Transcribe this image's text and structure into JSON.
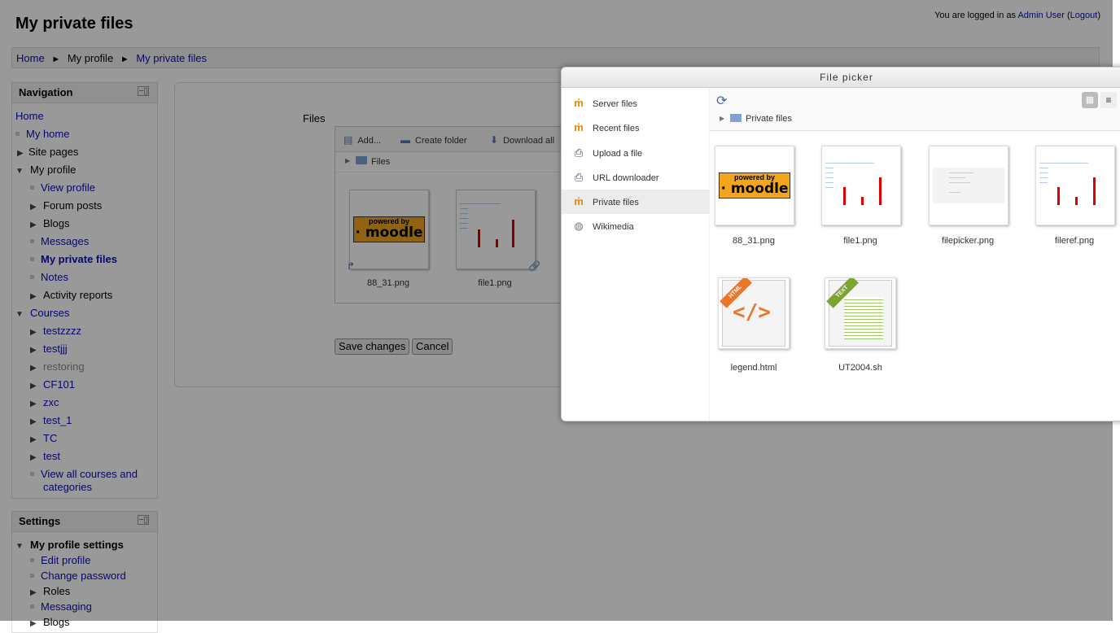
{
  "page": {
    "title": "My private files",
    "login": {
      "prefix": "You are logged in as ",
      "user": "Admin User",
      "logout": "Logout"
    }
  },
  "breadcrumb": {
    "home": "Home",
    "profile": "My profile",
    "current": "My private files",
    "sep": "►"
  },
  "navigation": {
    "title": "Navigation",
    "items": [
      {
        "label": "Home"
      },
      {
        "label": "My home"
      },
      {
        "label": "Site pages"
      },
      {
        "label": "My profile"
      },
      {
        "label": "View profile"
      },
      {
        "label": "Forum posts"
      },
      {
        "label": "Blogs"
      },
      {
        "label": "Messages"
      },
      {
        "label": "My private files"
      },
      {
        "label": "Notes"
      },
      {
        "label": "Activity reports"
      },
      {
        "label": "Courses"
      },
      {
        "label": "testzzzz"
      },
      {
        "label": "testjjj"
      },
      {
        "label": "restoring"
      },
      {
        "label": "CF101"
      },
      {
        "label": "zxc"
      },
      {
        "label": "test_1"
      },
      {
        "label": "TC"
      },
      {
        "label": "test"
      },
      {
        "label": "View all courses and"
      },
      {
        "label": "categories"
      }
    ]
  },
  "settings": {
    "title": "Settings",
    "items": [
      {
        "label": "My profile settings"
      },
      {
        "label": "Edit profile"
      },
      {
        "label": "Change password"
      },
      {
        "label": "Roles"
      },
      {
        "label": "Messaging"
      },
      {
        "label": "Blogs"
      }
    ]
  },
  "files_form": {
    "label": "Files",
    "toolbar": {
      "add": "Add...",
      "create_folder": "Create folder",
      "download_all": "Download all"
    },
    "path": "Files",
    "files": [
      {
        "name": "88_31.png"
      },
      {
        "name": "file1.png"
      }
    ],
    "save": "Save changes",
    "cancel": "Cancel"
  },
  "file_picker": {
    "title": "File picker",
    "repositories": [
      {
        "label": "Server files",
        "icon": "moodle-icon"
      },
      {
        "label": "Recent files",
        "icon": "moodle-icon"
      },
      {
        "label": "Upload a file",
        "icon": "upload-icon"
      },
      {
        "label": "URL downloader",
        "icon": "url-download-icon"
      },
      {
        "label": "Private files",
        "icon": "moodle-icon",
        "selected": true
      },
      {
        "label": "Wikimedia",
        "icon": "wikimedia-icon"
      }
    ],
    "path": "Private files",
    "files": [
      {
        "name": "88_31.png"
      },
      {
        "name": "file1.png"
      },
      {
        "name": "filepicker.png"
      },
      {
        "name": "fileref.png"
      },
      {
        "name": "legend.html",
        "badge": "HTML"
      },
      {
        "name": "UT2004.sh",
        "badge": "TEXT"
      }
    ]
  },
  "moodle_badge": {
    "line1": "powered by",
    "line2": "· moodle"
  },
  "colors": {
    "link": "#0b0bb5",
    "moodle_orange": "#f2a51d",
    "chart_bar": "#dd0000"
  }
}
